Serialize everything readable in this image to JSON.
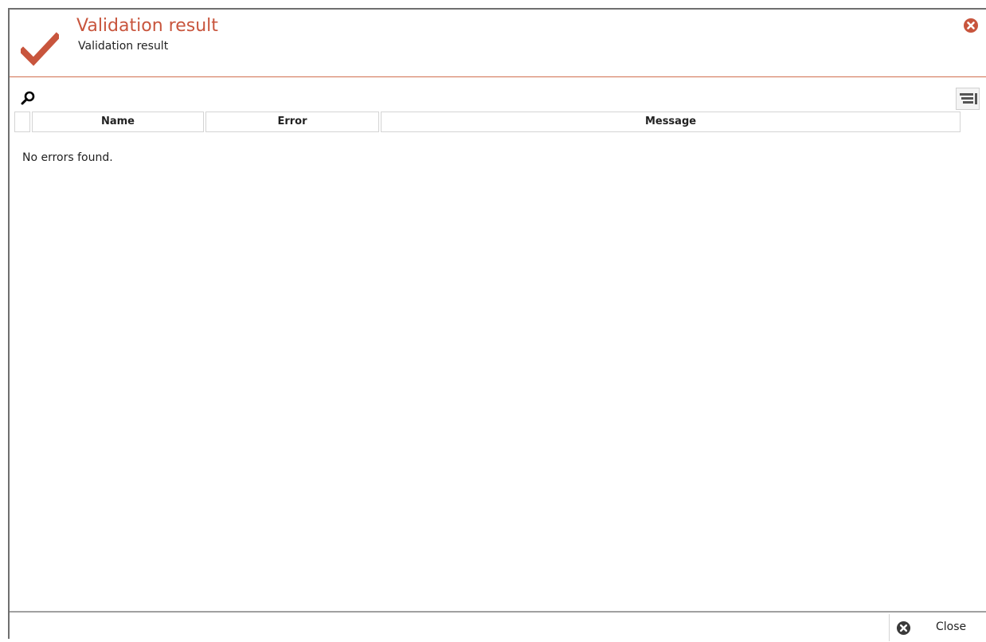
{
  "dialog": {
    "title": "Validation result",
    "subtitle": "Validation result",
    "accent_color": "#c8553d",
    "header_icon": "checkmark-icon",
    "close_icon": "close-circle-icon"
  },
  "toolbar": {
    "search_icon": "search-icon",
    "column_chooser_icon": "column-chooser-icon"
  },
  "grid": {
    "columns": [
      "Name",
      "Error",
      "Message"
    ],
    "rows": [],
    "empty_text": "No errors found."
  },
  "footer": {
    "close_label": "Close",
    "close_icon": "close-circle-icon"
  }
}
